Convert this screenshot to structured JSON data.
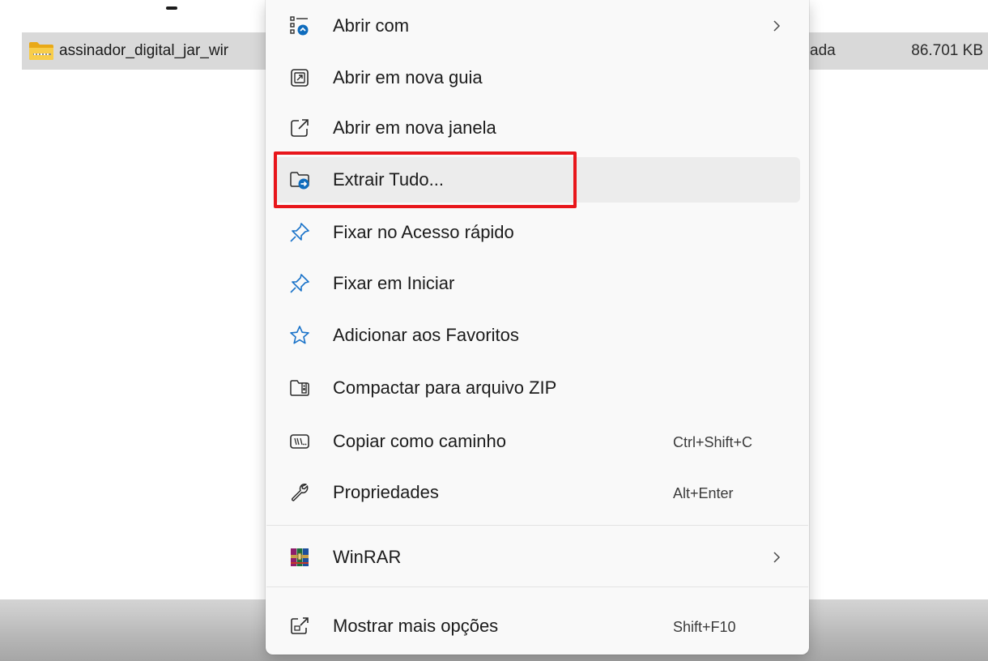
{
  "file_row": {
    "name": "assinador_digital_jar_wir",
    "type_fragment": "ada",
    "size": "86.701 KB"
  },
  "menu": {
    "items": [
      {
        "label": "Abrir com",
        "icon": "open-with-icon",
        "has_submenu": true
      },
      {
        "label": "Abrir em nova guia",
        "icon": "new-tab-icon"
      },
      {
        "label": "Abrir em nova janela",
        "icon": "new-window-icon"
      },
      {
        "label": "Extrair Tudo...",
        "icon": "extract-all-icon",
        "highlighted": true
      },
      {
        "label": "Fixar no Acesso rápido",
        "icon": "pin-icon"
      },
      {
        "label": "Fixar em Iniciar",
        "icon": "pin-icon"
      },
      {
        "label": "Adicionar aos Favoritos",
        "icon": "star-icon"
      },
      {
        "label": "Compactar para arquivo ZIP",
        "icon": "zip-icon"
      },
      {
        "label": "Copiar como caminho",
        "icon": "copy-path-icon",
        "shortcut": "Ctrl+Shift+C"
      },
      {
        "label": "Propriedades",
        "icon": "wrench-icon",
        "shortcut": "Alt+Enter"
      },
      {
        "label": "WinRAR",
        "icon": "winrar-icon",
        "has_submenu": true
      },
      {
        "label": "Mostrar mais opções",
        "icon": "more-options-icon",
        "shortcut": "Shift+F10"
      }
    ]
  },
  "colors": {
    "accent": "#0067c0",
    "highlight_border": "#e8161b",
    "selected_row": "#d9d9d9",
    "menu_background": "#f9f9f9"
  }
}
